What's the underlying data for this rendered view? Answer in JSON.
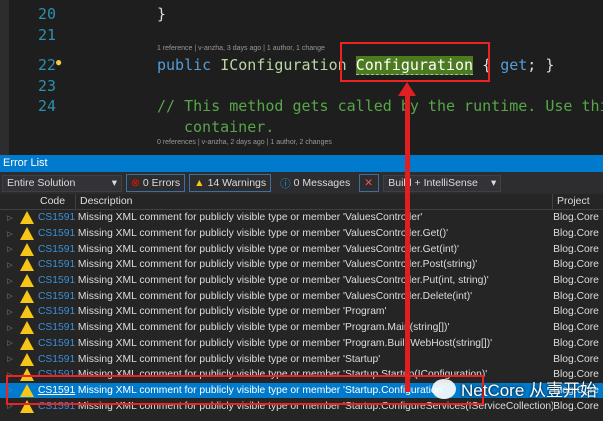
{
  "editor": {
    "line_numbers": [
      "20",
      "21",
      "22",
      "23",
      "24"
    ],
    "line20": "}",
    "lens1": "1 reference | v-anzha, 3 days ago | 1 author, 1 change",
    "line22": {
      "kw": "public",
      "type": "IConfiguration",
      "name": "Configuration",
      "rest1": "{",
      "kw2": "get",
      "rest2": "; }"
    },
    "line24": "// This method gets called by the runtime. Use thi",
    "line24b": "container.",
    "lens2": "0 references | v-anzha, 2 days ago | 1 author, 2 changes"
  },
  "panel": {
    "title": "Error List",
    "scope": "Entire Solution",
    "errors": "0 Errors",
    "warnings": "14 Warnings",
    "messages": "0 Messages",
    "build_filter": "Build + IntelliSense",
    "columns": [
      "Code",
      "Description",
      "Project"
    ],
    "rows": [
      {
        "code": "CS1591",
        "desc": "Missing XML comment for publicly visible type or member 'ValuesController'",
        "project": "Blog.Core"
      },
      {
        "code": "CS1591",
        "desc": "Missing XML comment for publicly visible type or member 'ValuesController.Get()'",
        "project": "Blog.Core"
      },
      {
        "code": "CS1591",
        "desc": "Missing XML comment for publicly visible type or member 'ValuesController.Get(int)'",
        "project": "Blog.Core"
      },
      {
        "code": "CS1591",
        "desc": "Missing XML comment for publicly visible type or member 'ValuesController.Post(string)'",
        "project": "Blog.Core"
      },
      {
        "code": "CS1591",
        "desc": "Missing XML comment for publicly visible type or member 'ValuesController.Put(int, string)'",
        "project": "Blog.Core"
      },
      {
        "code": "CS1591",
        "desc": "Missing XML comment for publicly visible type or member 'ValuesController.Delete(int)'",
        "project": "Blog.Core"
      },
      {
        "code": "CS1591",
        "desc": "Missing XML comment for publicly visible type or member 'Program'",
        "project": "Blog.Core"
      },
      {
        "code": "CS1591",
        "desc": "Missing XML comment for publicly visible type or member 'Program.Main(string[])'",
        "project": "Blog.Core"
      },
      {
        "code": "CS1591",
        "desc": "Missing XML comment for publicly visible type or member 'Program.BuildWebHost(string[])'",
        "project": "Blog.Core"
      },
      {
        "code": "CS1591",
        "desc": "Missing XML comment for publicly visible type or member 'Startup'",
        "project": "Blog.Core"
      },
      {
        "code": "CS1591",
        "desc": "Missing XML comment for publicly visible type or member 'Startup.Startup(IConfiguration)'",
        "project": "Blog.Core"
      },
      {
        "code": "CS1591",
        "desc": "Missing XML comment for publicly visible type or member 'Startup.Configuration'",
        "project": "Blog.Core",
        "selected": true
      },
      {
        "code": "CS1591",
        "desc": "Missing XML comment for publicly visible type or member 'Startup.ConfigureServices(IServiceCollection)'",
        "project": "Blog.Core"
      }
    ]
  },
  "watermark": "NetCore 从壹开始"
}
